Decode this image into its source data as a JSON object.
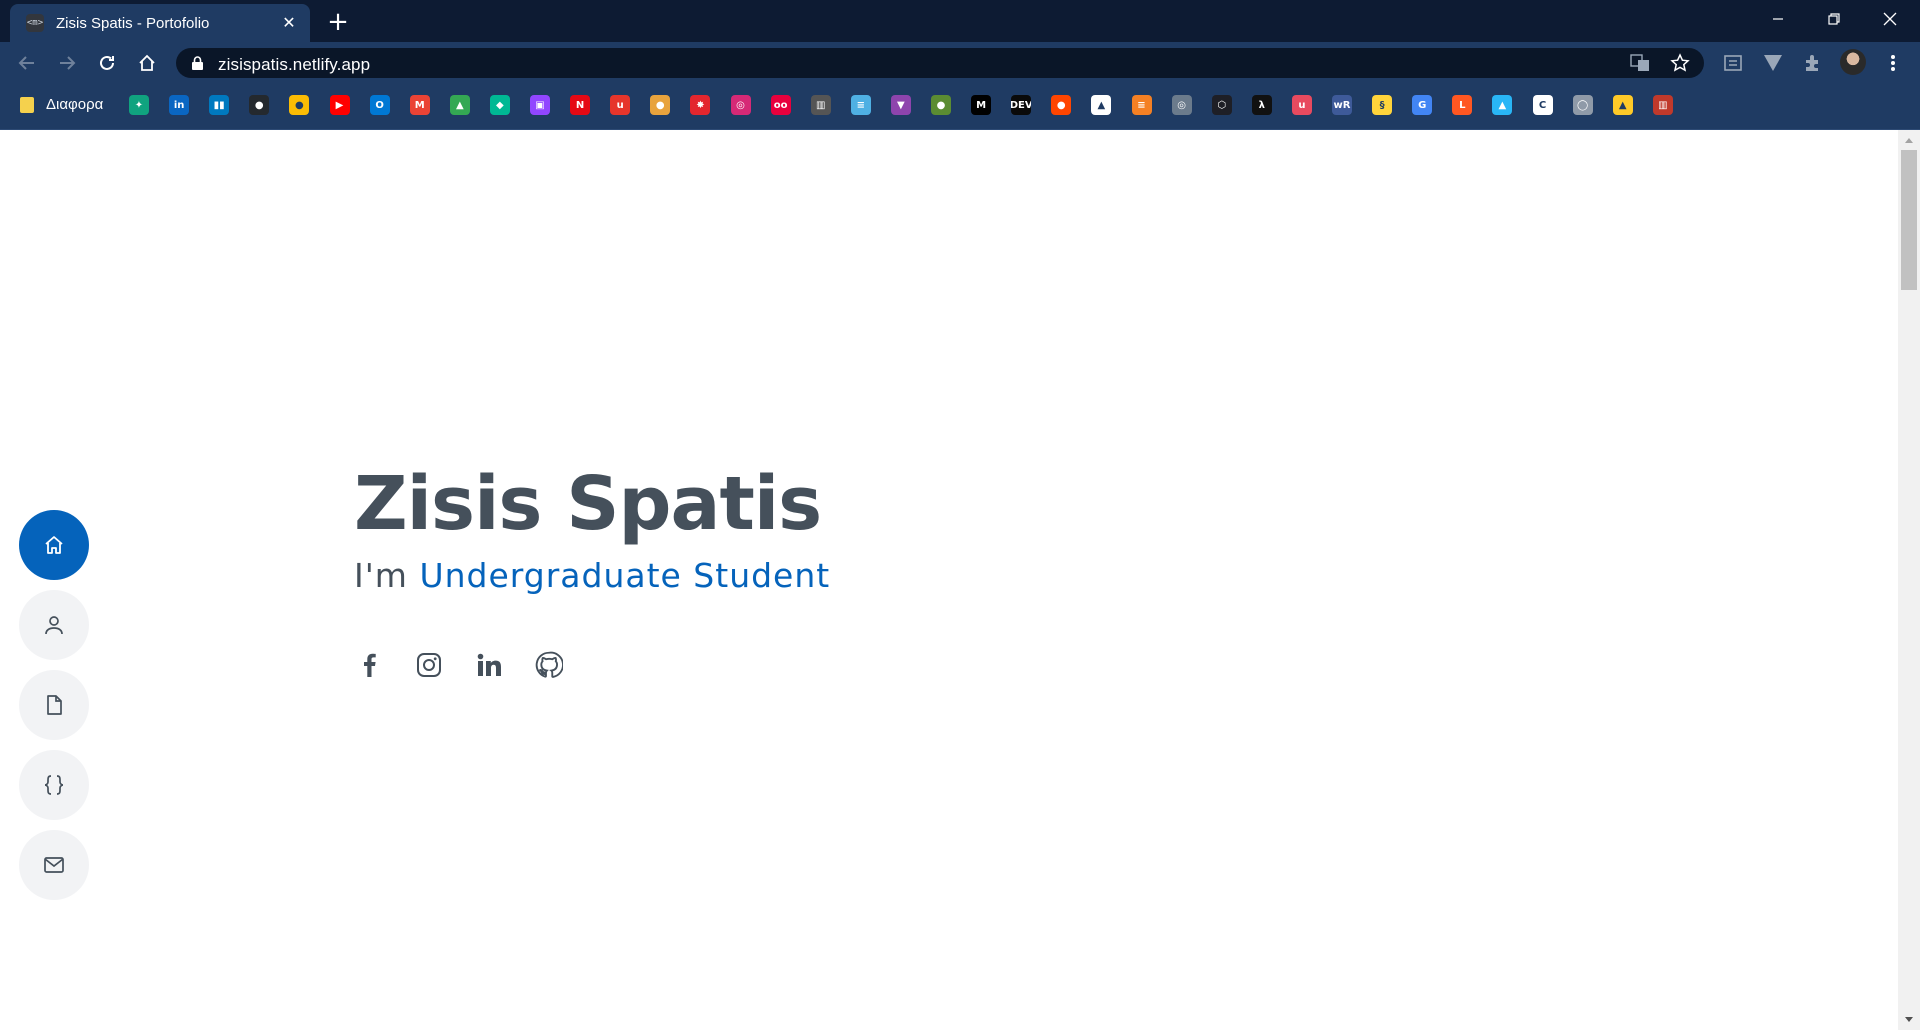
{
  "browser": {
    "tab_title": "Zisis Spatis - Portofolio",
    "tab_favicon_text": "<m>",
    "url": "zisispatis.netlify.app",
    "bookmark_folder": "Διαφορα",
    "bookmarks": [
      {
        "icon": "chatgpt-icon",
        "color": "#10a37f",
        "text": "✦"
      },
      {
        "icon": "linkedin-icon",
        "color": "#0a66c2",
        "text": "in"
      },
      {
        "icon": "trello-icon",
        "color": "#0079bf",
        "text": "▮▮"
      },
      {
        "icon": "github-icon",
        "color": "#24292e",
        "text": "●"
      },
      {
        "icon": "keep-icon",
        "color": "#fbbc04",
        "text": "●"
      },
      {
        "icon": "youtube-icon",
        "color": "#ff0000",
        "text": "▶"
      },
      {
        "icon": "outlook-icon",
        "color": "#0078d4",
        "text": "O"
      },
      {
        "icon": "gmail-icon",
        "color": "#ea4335",
        "text": "M"
      },
      {
        "icon": "drive-icon",
        "color": "#34a853",
        "text": "▲"
      },
      {
        "icon": "diamond-icon",
        "color": "#00b894",
        "text": "◆"
      },
      {
        "icon": "twitch-icon",
        "color": "#9146ff",
        "text": "▣"
      },
      {
        "icon": "netflix-icon",
        "color": "#e50914",
        "text": "N"
      },
      {
        "icon": "udemy-icon",
        "color": "#e6352b",
        "text": "u"
      },
      {
        "icon": "sonar-icon",
        "color": "#e8a33d",
        "text": "●"
      },
      {
        "icon": "red-star-icon",
        "color": "#e3262e",
        "text": "✸"
      },
      {
        "icon": "instagram-icon",
        "color": "#d62976",
        "text": "◎"
      },
      {
        "icon": "flickr-icon",
        "color": "#e8003d",
        "text": "oo"
      },
      {
        "icon": "archive-icon",
        "color": "#555555",
        "text": "▥"
      },
      {
        "icon": "document-icon",
        "color": "#4fb0e3",
        "text": "≡"
      },
      {
        "icon": "vue-icon",
        "color": "#8e44ad",
        "text": "▼"
      },
      {
        "icon": "leaf-icon",
        "color": "#5b8c32",
        "text": "●"
      },
      {
        "icon": "medium-icon",
        "color": "#000000",
        "text": "M"
      },
      {
        "icon": "dev-icon",
        "color": "#0a0a0a",
        "text": "DEV"
      },
      {
        "icon": "reddit-icon",
        "color": "#ff4500",
        "text": "●"
      },
      {
        "icon": "hat-icon",
        "color": "#ffffff",
        "text": "▲"
      },
      {
        "icon": "stackoverflow-icon",
        "color": "#f48024",
        "text": "≡"
      },
      {
        "icon": "spiral-icon",
        "color": "#6b7b8c",
        "text": "◎"
      },
      {
        "icon": "codepen-icon",
        "color": "#1e1f26",
        "text": "⬡"
      },
      {
        "icon": "lambda-icon",
        "color": "#111111",
        "text": "λ"
      },
      {
        "icon": "u-icon",
        "color": "#e84a5f",
        "text": "u"
      },
      {
        "icon": "wr-icon",
        "color": "#3e5a99",
        "text": "wR"
      },
      {
        "icon": "python-icon",
        "color": "#ffd43b",
        "text": "§"
      },
      {
        "icon": "translate-icon",
        "color": "#4285f4",
        "text": "G"
      },
      {
        "icon": "l-icon",
        "color": "#ff5722",
        "text": "L"
      },
      {
        "icon": "image-icon",
        "color": "#29b6f6",
        "text": "▲"
      },
      {
        "icon": "c-icon",
        "color": "#ffffff",
        "text": "C"
      },
      {
        "icon": "bulb-icon",
        "color": "#8f9aa8",
        "text": "◯"
      },
      {
        "icon": "firebase-icon",
        "color": "#ffca28",
        "text": "▲"
      },
      {
        "icon": "castle-icon",
        "color": "#c0392b",
        "text": "▥"
      }
    ]
  },
  "sidenav": [
    {
      "name": "home",
      "active": true
    },
    {
      "name": "about",
      "active": false
    },
    {
      "name": "resume",
      "active": false
    },
    {
      "name": "projects",
      "active": false
    },
    {
      "name": "contact",
      "active": false
    }
  ],
  "hero": {
    "name": "Zisis Spatis",
    "prefix": "I'm",
    "role": "Undergraduate Student"
  },
  "socials": [
    "facebook-icon",
    "instagram-icon",
    "linkedin-icon",
    "github-icon"
  ],
  "colors": {
    "accent": "#0563bb",
    "text": "#45505b",
    "nav_bg": "#f2f3f5"
  }
}
